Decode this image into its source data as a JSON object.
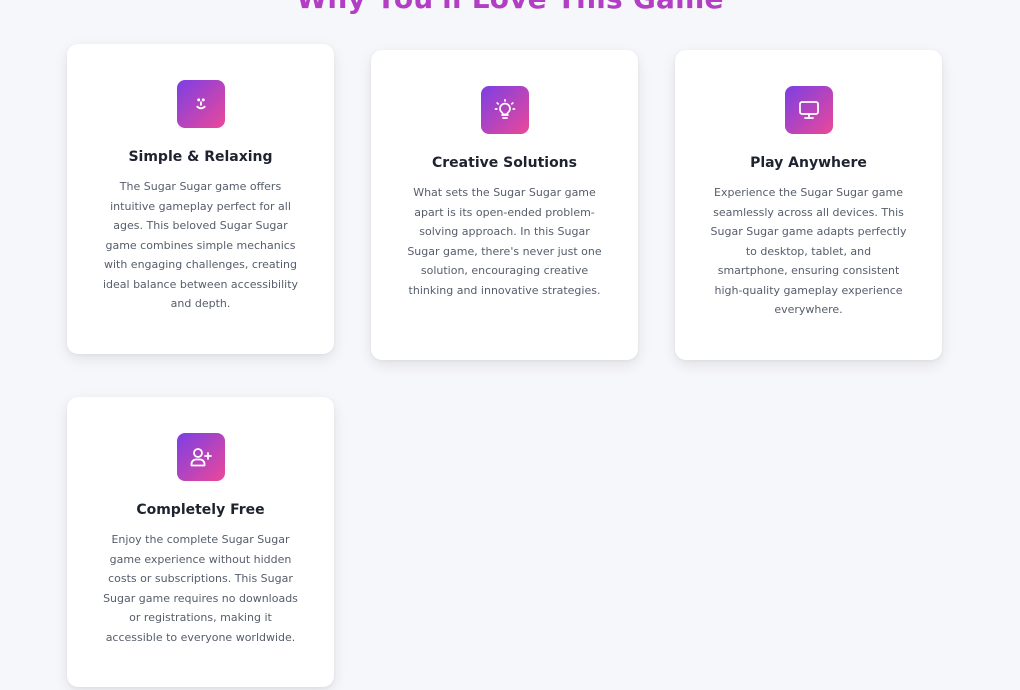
{
  "section": {
    "title": "Why You'll Love This Game"
  },
  "features": [
    {
      "icon": "smile-icon",
      "title": "Simple & Relaxing",
      "description": "The Sugar Sugar game offers intuitive gameplay perfect for all ages. This beloved Sugar Sugar game combines simple mechanics with engaging challenges, creating ideal balance between accessibility and depth."
    },
    {
      "icon": "lightbulb-icon",
      "title": "Creative Solutions",
      "description": "What sets the Sugar Sugar game apart is its open-ended problem-solving approach. In this Sugar Sugar game, there's never just one solution, encouraging creative thinking and innovative strategies."
    },
    {
      "icon": "monitor-icon",
      "title": "Play Anywhere",
      "description": "Experience the Sugar Sugar game seamlessly across all devices. This Sugar Sugar game adapts perfectly to desktop, tablet, and smartphone, ensuring consistent high-quality gameplay experience everywhere."
    },
    {
      "icon": "user-plus-icon",
      "title": "Completely Free",
      "description": "Enjoy the complete Sugar Sugar game experience without hidden costs or subscriptions. This Sugar Sugar game requires no downloads or registrations, making it accessible to everyone worldwide."
    }
  ],
  "colors": {
    "background": "#f6f7fa",
    "title": "#b23fc3",
    "gradient_start": "#7b3fe4",
    "gradient_end": "#ec4899",
    "card": "#ffffff",
    "card_title": "#1e2330",
    "card_text": "#565d6b"
  }
}
